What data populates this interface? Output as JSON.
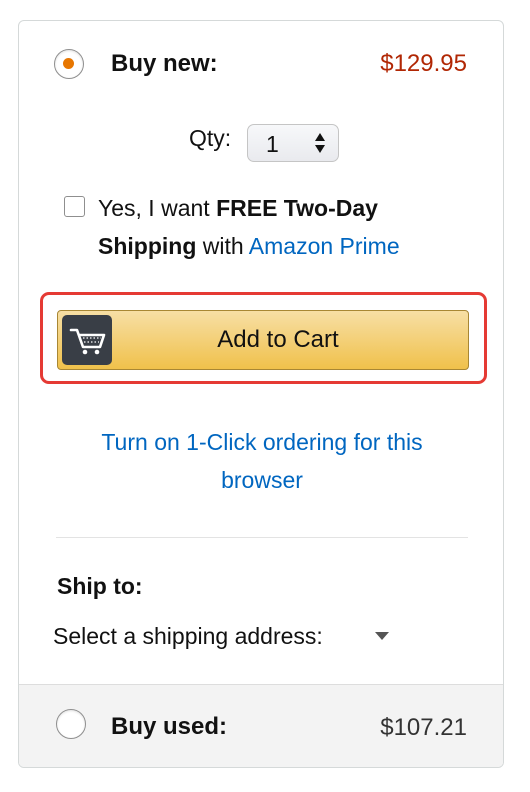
{
  "buy_new": {
    "label": "Buy new:",
    "price": "$129.95",
    "selected": true
  },
  "quantity": {
    "label": "Qty:",
    "value": "1"
  },
  "prime_offer": {
    "prefix": "Yes, I want ",
    "bold": "FREE Two-Day Shipping",
    "middle": " with ",
    "link": "Amazon Prime",
    "checked": false
  },
  "add_to_cart": {
    "label": "Add to Cart",
    "icon": "cart-icon"
  },
  "one_click": {
    "line1": "Turn on 1-Click ordering for this",
    "line2": "browser"
  },
  "ship_to": {
    "heading": "Ship to:",
    "select_text": "Select a shipping address:"
  },
  "buy_used": {
    "label": "Buy used:",
    "price": "$107.21",
    "selected": false
  },
  "colors": {
    "price_red": "#b12704",
    "link_blue": "#0066c0",
    "radio_orange": "#e77600",
    "button_gold": "#f0c14b",
    "highlight_red": "#e53a34"
  }
}
